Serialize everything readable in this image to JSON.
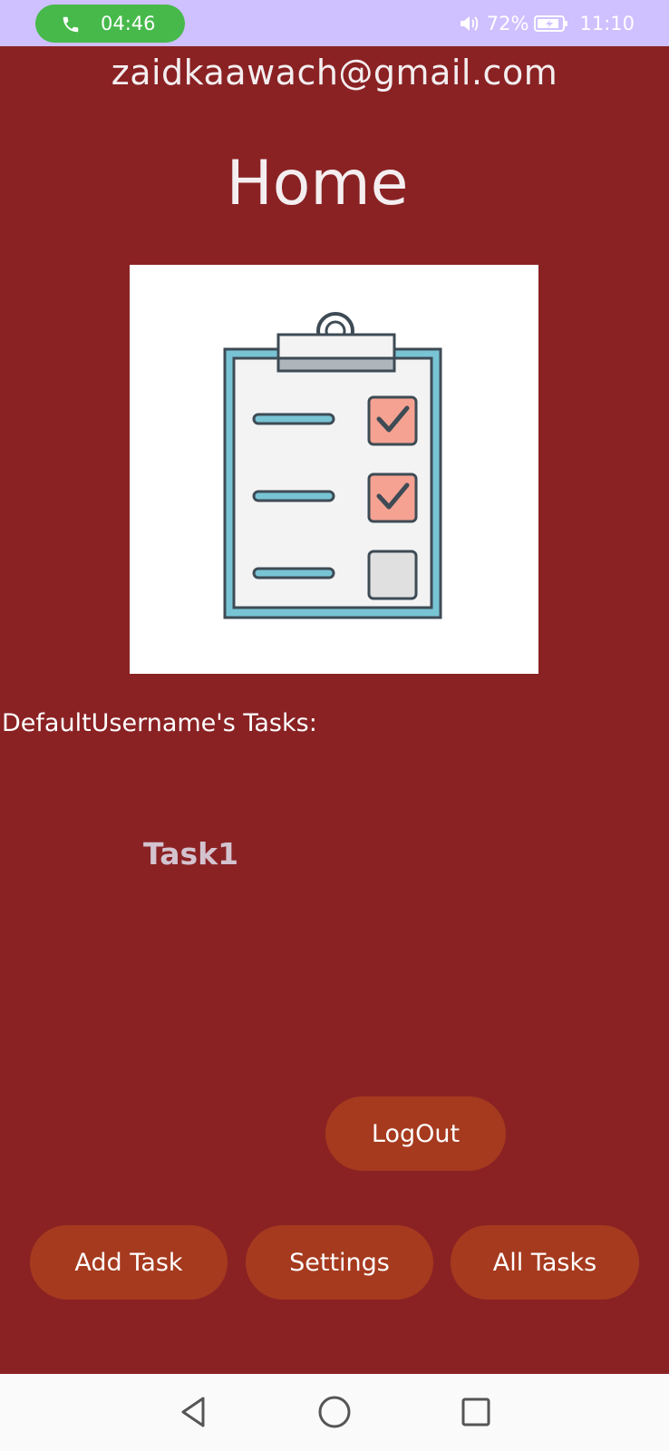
{
  "status_bar": {
    "call_time": "04:46",
    "battery": "72%",
    "clock": "11:10",
    "icons": [
      "phone-icon",
      "volume-icon",
      "battery-charging-icon"
    ],
    "colors": {
      "background": "#cfc0ff",
      "call_pill": "#46b94a"
    }
  },
  "header": {
    "email": "zaidkaawach@gmail.com",
    "title": "Home"
  },
  "hero": {
    "icon": "clipboard-checklist-icon"
  },
  "tasks": {
    "heading": "DefaultUsername's Tasks:",
    "items": [
      "Task1"
    ]
  },
  "buttons": {
    "logout": "LogOut",
    "add_task": "Add Task",
    "settings": "Settings",
    "all_tasks": "All Tasks"
  },
  "nav": {
    "icons": [
      "back-icon",
      "home-icon",
      "recent-apps-icon"
    ]
  },
  "colors": {
    "background": "#8a2224",
    "button": "#a63a1e",
    "task_text": "#d3c3cf"
  }
}
